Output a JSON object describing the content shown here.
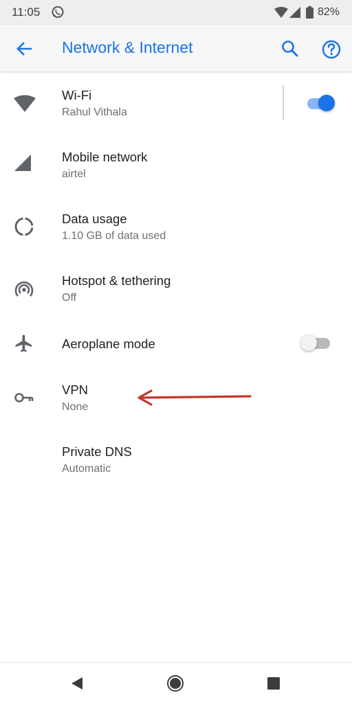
{
  "status_bar": {
    "time": "11:05",
    "battery": "82%"
  },
  "app_bar": {
    "title": "Network & Internet",
    "accent_color": "#1a73e8"
  },
  "settings": [
    {
      "title": "Wi-Fi",
      "summary": "Rahul Vithala",
      "icon": "wifi-icon",
      "toggle": "on"
    },
    {
      "title": "Mobile network",
      "summary": "airtel",
      "icon": "signal-icon"
    },
    {
      "title": "Data usage",
      "summary": "1.10 GB of data used",
      "icon": "data-usage-icon"
    },
    {
      "title": "Hotspot & tethering",
      "summary": "Off",
      "icon": "hotspot-icon"
    },
    {
      "title": "Aeroplane mode",
      "icon": "airplane-icon",
      "toggle": "off"
    },
    {
      "title": "VPN",
      "summary": "None",
      "icon": "key-icon"
    },
    {
      "title": "Private DNS",
      "summary": "Automatic"
    }
  ],
  "annotation": {
    "arrow_color": "#c0392b",
    "points_to": "VPN"
  }
}
